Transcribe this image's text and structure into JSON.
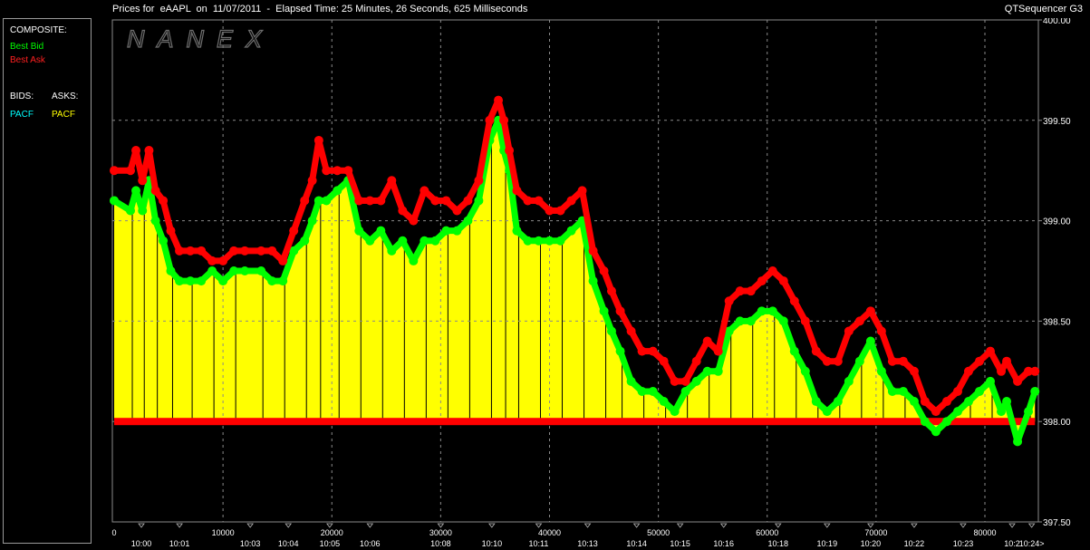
{
  "title": "Prices for  eAAPL  on  11/07/2011  -  Elapsed Time: 25 Minutes, 26 Seconds, 625 Milliseconds",
  "app_name": "QTSequencer G3",
  "watermark": "NANEX",
  "legend": {
    "composite_label": "COMPOSITE:",
    "best_bid": "Best Bid",
    "best_ask": "Best Ask",
    "bids_label": "BIDS:",
    "asks_label": "ASKS:",
    "bid_exchange": "PACF",
    "ask_exchange": "PACF",
    "colors": {
      "best_bid": "#00ff00",
      "best_ask": "#ff0000",
      "bid_exchange": "#00ffff",
      "ask_exchange": "#ffff00",
      "text": "#ffffff"
    }
  },
  "chart_data": {
    "type": "area",
    "title": "Prices for  eAAPL  on  11/07/2011",
    "ylim": [
      397.5,
      400.0
    ],
    "y_ticks": [
      "400.00",
      "399.50",
      "399.00",
      "398.50",
      "398.00",
      "397.50"
    ],
    "xlim": [
      0,
      85000
    ],
    "x_ticks": [
      {
        "value": 0,
        "label": "0"
      },
      {
        "value": 10000,
        "label": "10000"
      },
      {
        "value": 20000,
        "label": "20000"
      },
      {
        "value": 30000,
        "label": "30000"
      },
      {
        "value": 40000,
        "label": "40000"
      },
      {
        "value": 50000,
        "label": "50000"
      },
      {
        "value": 60000,
        "label": "60000"
      },
      {
        "value": 70000,
        "label": "70000"
      },
      {
        "value": 80000,
        "label": "80000"
      }
    ],
    "time_ticks": [
      {
        "x": 2500,
        "label": "10:00"
      },
      {
        "x": 6000,
        "label": "10:01"
      },
      {
        "x": 12500,
        "label": "10:03"
      },
      {
        "x": 16000,
        "label": "10:04"
      },
      {
        "x": 19800,
        "label": "10:05"
      },
      {
        "x": 23500,
        "label": "10:06"
      },
      {
        "x": 30000,
        "label": "10:08"
      },
      {
        "x": 34700,
        "label": "10:10"
      },
      {
        "x": 39000,
        "label": "10:11"
      },
      {
        "x": 43500,
        "label": "10:13"
      },
      {
        "x": 48000,
        "label": "10:14"
      },
      {
        "x": 52000,
        "label": "10:15"
      },
      {
        "x": 56000,
        "label": "10:16"
      },
      {
        "x": 61000,
        "label": "10:18"
      },
      {
        "x": 65500,
        "label": "10:19"
      },
      {
        "x": 69500,
        "label": "10:20"
      },
      {
        "x": 73500,
        "label": "10:22"
      },
      {
        "x": 78000,
        "label": "10:23"
      },
      {
        "x": 82500,
        "label": "10:2"
      },
      {
        "x": 84300,
        "label": "10:24>"
      }
    ],
    "grid": true,
    "series": [
      {
        "name": "Best Ask",
        "color": "#ff0000",
        "x": [
          0,
          1500,
          2000,
          2600,
          3200,
          3800,
          4500,
          5200,
          6000,
          7000,
          8000,
          9000,
          10000,
          11000,
          12000,
          13500,
          14500,
          15500,
          16500,
          17500,
          18200,
          18800,
          19500,
          20500,
          21500,
          22500,
          23500,
          24500,
          25500,
          26500,
          27500,
          28500,
          29500,
          30500,
          31500,
          32500,
          33500,
          34500,
          35300,
          35800,
          36300,
          37000,
          38000,
          39000,
          40000,
          41000,
          42000,
          43000,
          44000,
          45000,
          45700,
          46500,
          47500,
          48500,
          49500,
          50500,
          51500,
          52500,
          53500,
          54500,
          55500,
          56500,
          57500,
          58500,
          59500,
          60500,
          61500,
          62500,
          63500,
          64500,
          65500,
          66500,
          67500,
          68500,
          69500,
          70500,
          71500,
          72500,
          73500,
          74500,
          75500,
          76500,
          77500,
          78500,
          79500,
          80500,
          81500,
          82000,
          83000,
          84000,
          84600
        ],
        "values": [
          399.25,
          399.25,
          399.35,
          399.2,
          399.35,
          399.15,
          399.1,
          398.95,
          398.85,
          398.85,
          398.85,
          398.8,
          398.8,
          398.85,
          398.85,
          398.85,
          398.85,
          398.8,
          398.95,
          399.1,
          399.2,
          399.4,
          399.25,
          399.25,
          399.25,
          399.1,
          399.1,
          399.1,
          399.2,
          399.05,
          399.0,
          399.15,
          399.1,
          399.1,
          399.05,
          399.1,
          399.2,
          399.5,
          399.6,
          399.5,
          399.35,
          399.15,
          399.1,
          399.1,
          399.05,
          399.05,
          399.1,
          399.15,
          398.85,
          398.75,
          398.65,
          398.55,
          398.45,
          398.35,
          398.35,
          398.3,
          398.2,
          398.2,
          398.3,
          398.4,
          398.35,
          398.6,
          398.65,
          398.65,
          398.7,
          398.75,
          398.7,
          398.6,
          398.5,
          398.35,
          398.3,
          398.3,
          398.45,
          398.5,
          398.55,
          398.45,
          398.3,
          398.3,
          398.25,
          398.1,
          398.05,
          398.1,
          398.15,
          398.25,
          398.3,
          398.35,
          398.25,
          398.3,
          398.2,
          398.25,
          398.25
        ]
      },
      {
        "name": "Best Bid",
        "color": "#00ff00",
        "x": [
          0,
          1500,
          2000,
          2600,
          3200,
          3800,
          4500,
          5200,
          6000,
          7000,
          8000,
          9000,
          10000,
          11000,
          12000,
          13500,
          14500,
          15500,
          16500,
          17500,
          18200,
          18800,
          19500,
          20500,
          21500,
          22500,
          23500,
          24500,
          25500,
          26500,
          27500,
          28500,
          29500,
          30500,
          31500,
          32500,
          33500,
          34500,
          35300,
          35800,
          36300,
          37000,
          38000,
          39000,
          40000,
          41000,
          42000,
          43000,
          44000,
          45000,
          45700,
          46500,
          47500,
          48500,
          49500,
          50500,
          51500,
          52500,
          53500,
          54500,
          55500,
          56500,
          57500,
          58500,
          59500,
          60500,
          61500,
          62500,
          63500,
          64500,
          65500,
          66500,
          67500,
          68500,
          69500,
          70500,
          71500,
          72500,
          73500,
          74500,
          75500,
          76500,
          77500,
          78500,
          79500,
          80500,
          81500,
          82000,
          83000,
          84000,
          84600
        ],
        "values": [
          399.1,
          399.05,
          399.15,
          399.05,
          399.2,
          399.0,
          398.9,
          398.75,
          398.7,
          398.7,
          398.7,
          398.75,
          398.7,
          398.75,
          398.75,
          398.75,
          398.7,
          398.7,
          398.85,
          398.9,
          399.0,
          399.1,
          399.1,
          399.15,
          399.2,
          398.95,
          398.9,
          398.95,
          398.85,
          398.9,
          398.8,
          398.9,
          398.9,
          398.95,
          398.95,
          399.0,
          399.1,
          399.4,
          399.5,
          399.35,
          399.25,
          398.95,
          398.9,
          398.9,
          398.9,
          398.9,
          398.95,
          399.0,
          398.7,
          398.55,
          398.45,
          398.35,
          398.2,
          398.15,
          398.15,
          398.1,
          398.05,
          398.15,
          398.2,
          398.25,
          398.25,
          398.45,
          398.5,
          398.5,
          398.55,
          398.55,
          398.5,
          398.35,
          398.25,
          398.1,
          398.05,
          398.1,
          398.2,
          398.3,
          398.4,
          398.25,
          398.15,
          398.15,
          398.1,
          398.0,
          397.95,
          398.0,
          398.05,
          398.1,
          398.15,
          398.2,
          398.05,
          398.1,
          397.9,
          398.05,
          398.15
        ]
      },
      {
        "name": "PACF",
        "color": "#ffff00",
        "x": [
          0,
          1500,
          2000,
          2600,
          3200,
          3800,
          4500,
          5200,
          6000,
          7000,
          8000,
          9000,
          10000,
          11000,
          12000,
          13500,
          14500,
          15500,
          16500,
          17500,
          18200,
          18800,
          19500,
          20500,
          21500,
          22500,
          23500,
          24500,
          25500,
          26500,
          27500,
          28500,
          29500,
          30500,
          31500,
          32500,
          33500,
          34500,
          35300,
          35800,
          36300,
          37000,
          38000,
          39000,
          40000,
          41000,
          42000,
          43000,
          44000,
          45000,
          45700,
          46500,
          47500,
          48500,
          49500,
          50500,
          51500,
          52500,
          53500,
          54500,
          55500,
          56500,
          57500,
          58500,
          59500,
          60500,
          61500,
          62500,
          63500,
          64500,
          65500,
          66500,
          67500,
          68500,
          69500,
          70500,
          71500,
          72500,
          73500,
          74500,
          75500,
          76500,
          77500,
          78500,
          79500,
          80500,
          81500,
          82000,
          83000,
          84000,
          84600
        ],
        "values": [
          399.1,
          399.05,
          399.15,
          399.05,
          399.2,
          399.0,
          398.9,
          398.75,
          398.7,
          398.7,
          398.7,
          398.75,
          398.7,
          398.75,
          398.75,
          398.75,
          398.7,
          398.7,
          398.85,
          398.9,
          399.0,
          399.1,
          399.1,
          399.15,
          399.2,
          398.95,
          398.9,
          398.95,
          398.85,
          398.9,
          398.8,
          398.9,
          398.9,
          398.95,
          398.95,
          399.0,
          399.1,
          399.4,
          399.5,
          399.35,
          399.25,
          398.95,
          398.9,
          398.9,
          398.9,
          398.9,
          398.95,
          399.0,
          398.7,
          398.55,
          398.45,
          398.35,
          398.2,
          398.15,
          398.15,
          398.1,
          398.05,
          398.15,
          398.2,
          398.25,
          398.25,
          398.45,
          398.5,
          398.5,
          398.55,
          398.55,
          398.5,
          398.35,
          398.25,
          398.1,
          398.05,
          398.1,
          398.2,
          398.3,
          398.4,
          398.25,
          398.15,
          398.15,
          398.1,
          398.0,
          397.95,
          398.0,
          398.05,
          398.1,
          398.15,
          398.2,
          398.05,
          398.1,
          397.9,
          398.05,
          398.15
        ]
      },
      {
        "name": "PACF ask",
        "color": "#ff0000",
        "x": [
          0,
          84600
        ],
        "values": [
          398.0,
          398.0
        ]
      }
    ]
  }
}
